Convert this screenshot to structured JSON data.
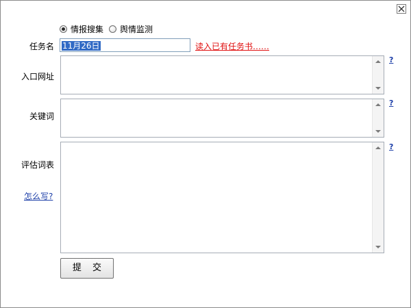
{
  "dialog": {
    "close_symbol": "×"
  },
  "mode": {
    "options": [
      {
        "label": "情报搜集",
        "selected": true
      },
      {
        "label": "舆情监测",
        "selected": false
      }
    ]
  },
  "form": {
    "task_name_label": "任务名",
    "task_name_value": "11月26日",
    "load_existing_link": "读入已有任务书……",
    "entry_url_label": "入口网址",
    "keywords_label": "关键词",
    "eval_terms_label": "评估词表",
    "how_to_write_link": "怎么写?",
    "help_mark": "?",
    "submit_label": "提 交"
  },
  "colors": {
    "selection_bg": "#316ac5",
    "link_red": "#e01010",
    "link_blue": "#1d3fa8"
  }
}
